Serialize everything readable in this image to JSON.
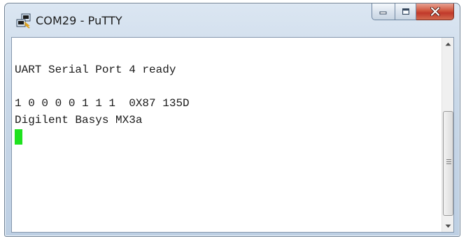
{
  "window": {
    "title": "COM29 - PuTTY",
    "icon": "putty-icon"
  },
  "controls": {
    "minimize_icon": "minimize-icon",
    "maximize_icon": "maximize-icon",
    "close_icon": "close-icon"
  },
  "terminal": {
    "lines": [
      "",
      "UART Serial Port 4 ready",
      "",
      "1 0 0 0 0 1 1 1  0X87 135D",
      "Digilent Basys MX3a"
    ],
    "cursor_color": "#1fe21f"
  },
  "colors": {
    "close_button": "#c0392b",
    "titlebar": "#c9d8e8"
  }
}
